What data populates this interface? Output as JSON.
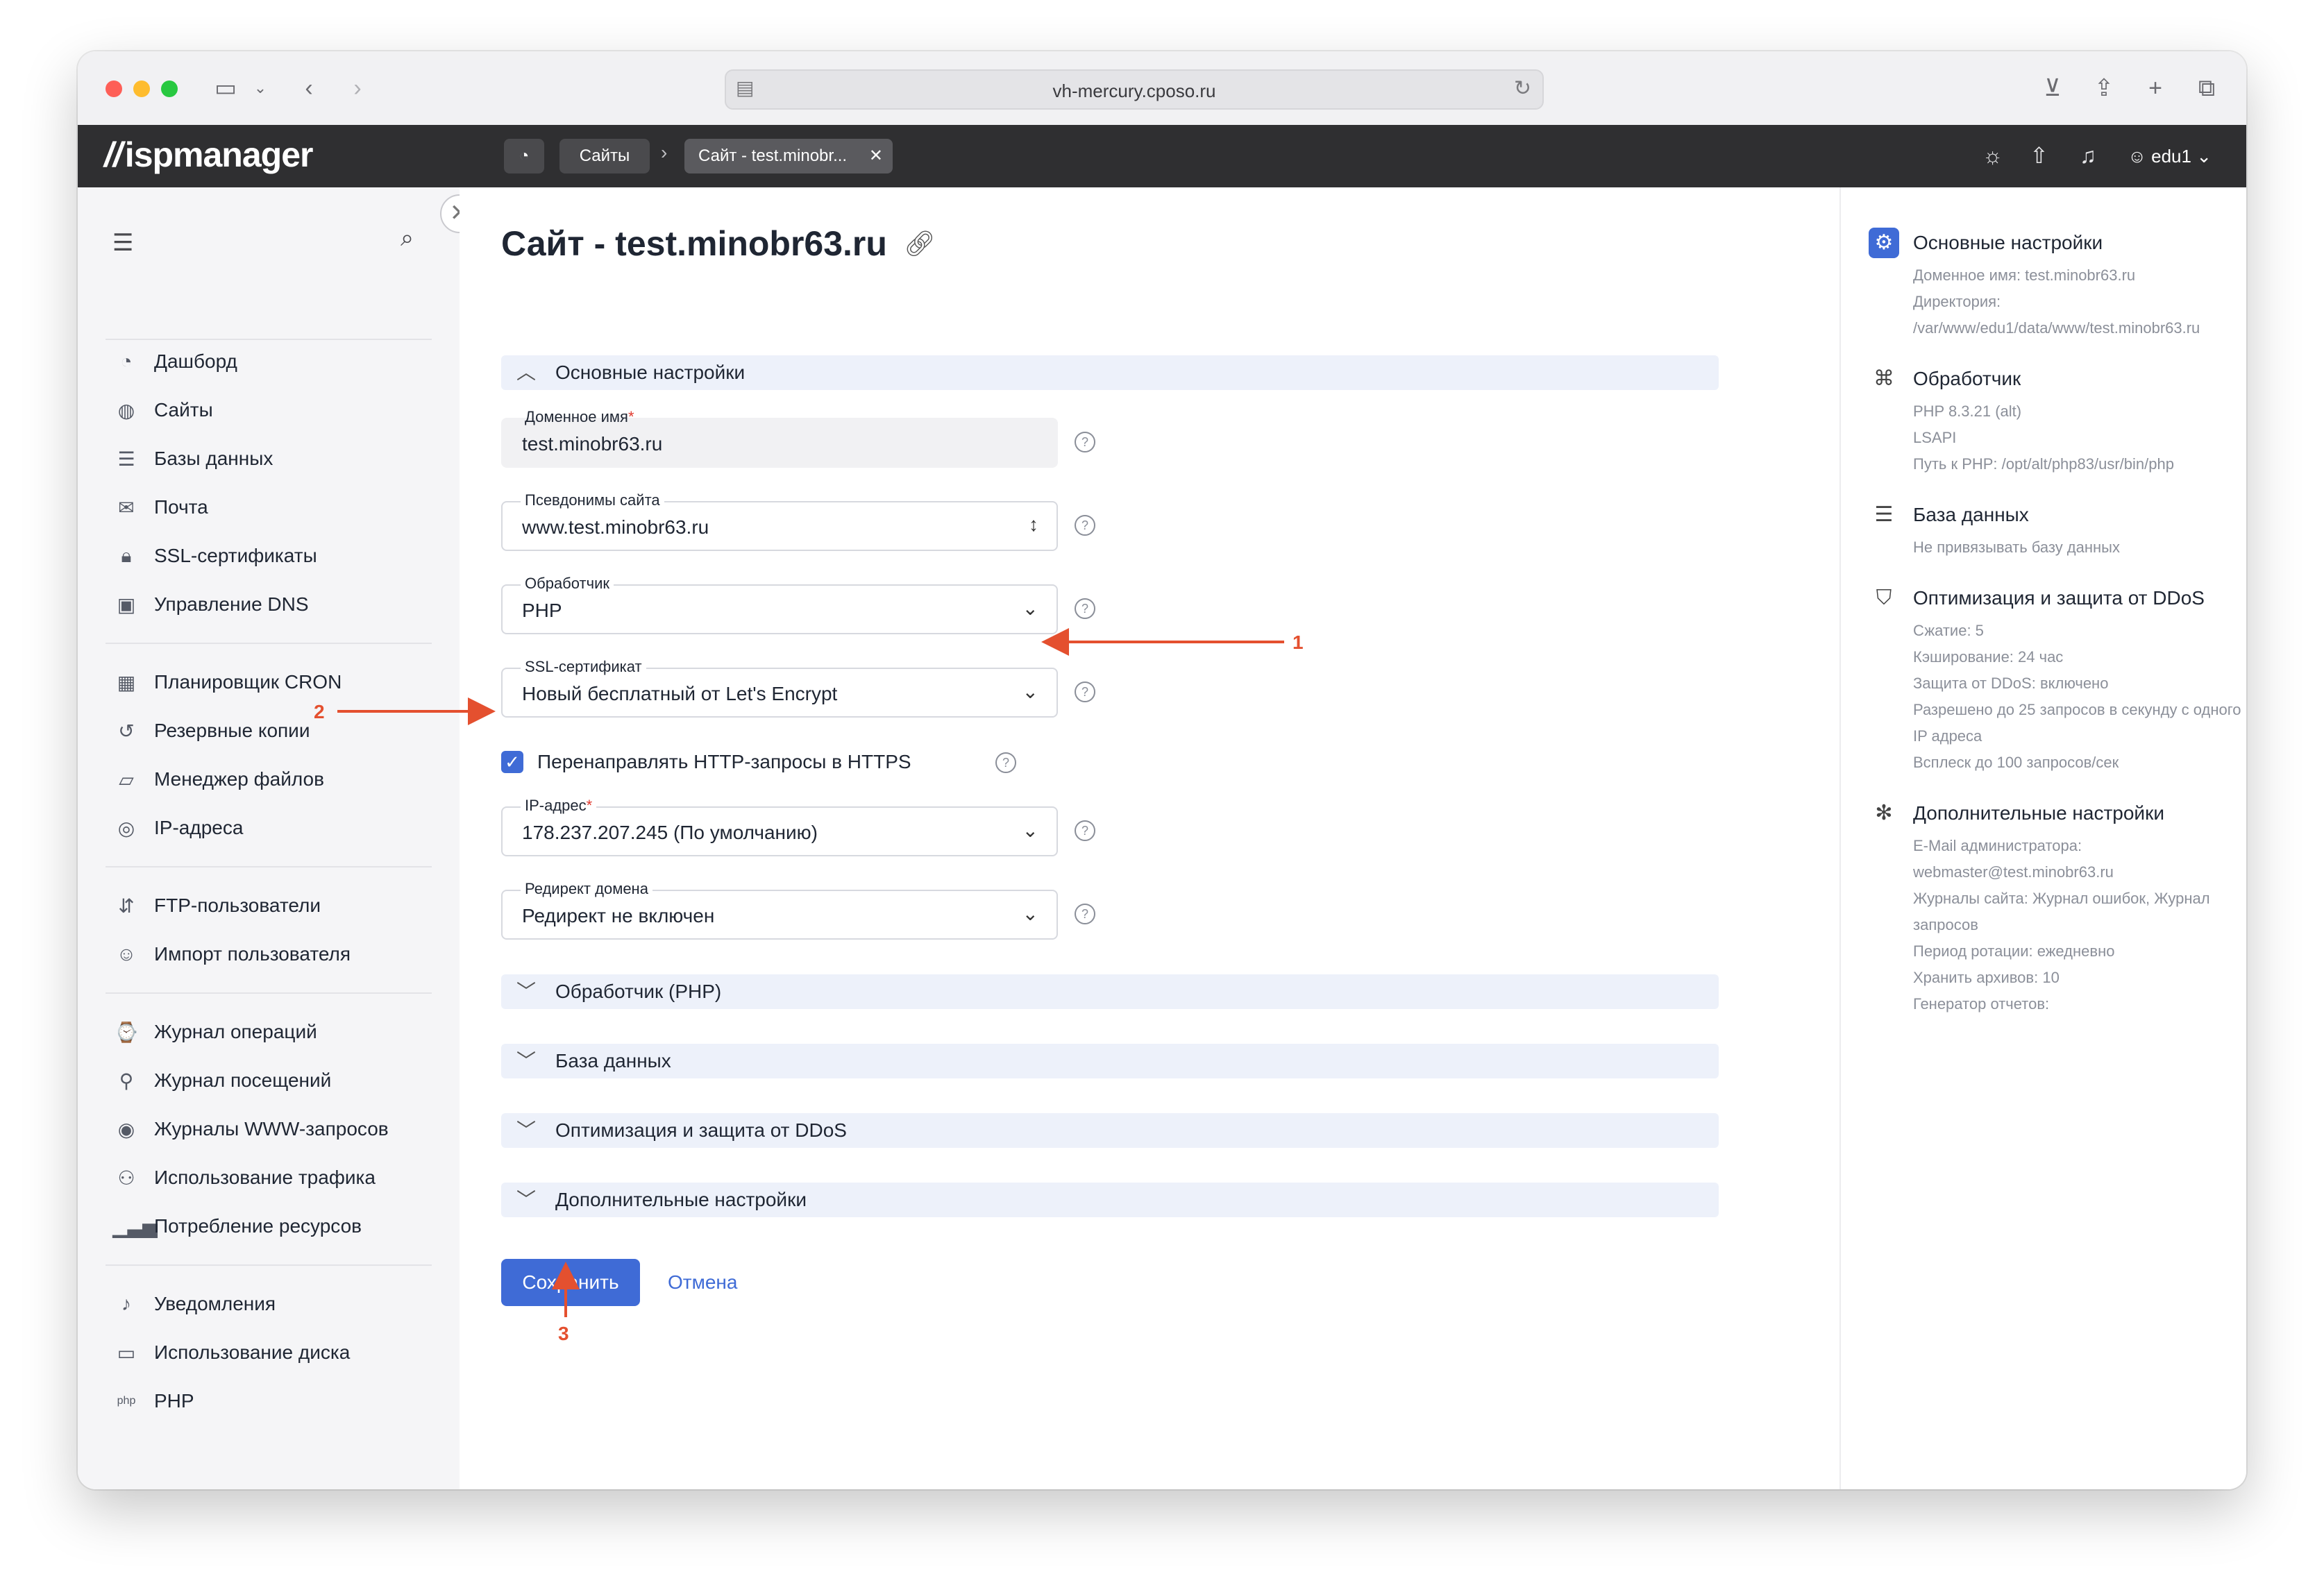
{
  "browser": {
    "url": "vh-mercury.cposo.ru"
  },
  "header": {
    "logo": "ispmanager",
    "breadcrumb_root": "Сайты",
    "breadcrumb_current": "Сайт - test.minobr...",
    "user": "edu1"
  },
  "sidebar": {
    "groups": [
      [
        {
          "label": "Дашборд",
          "icon": "dashboard-icon"
        },
        {
          "label": "Сайты",
          "icon": "globe-icon"
        },
        {
          "label": "Базы данных",
          "icon": "database-icon"
        },
        {
          "label": "Почта",
          "icon": "mail-icon"
        },
        {
          "label": "SSL-сертификаты",
          "icon": "lock-icon"
        },
        {
          "label": "Управление DNS",
          "icon": "dns-icon"
        }
      ],
      [
        {
          "label": "Планировщик CRON",
          "icon": "calendar-icon"
        },
        {
          "label": "Резервные копии",
          "icon": "backup-icon"
        },
        {
          "label": "Менеджер файлов",
          "icon": "folder-icon"
        },
        {
          "label": "IP-адреса",
          "icon": "ip-icon"
        }
      ],
      [
        {
          "label": "FTP-пользователи",
          "icon": "ftp-icon"
        },
        {
          "label": "Импорт пользователя",
          "icon": "user-import-icon"
        }
      ],
      [
        {
          "label": "Журнал операций",
          "icon": "log-icon"
        },
        {
          "label": "Журнал посещений",
          "icon": "visits-log-icon"
        },
        {
          "label": "Журналы WWW-запросов",
          "icon": "www-log-icon"
        },
        {
          "label": "Использование трафика",
          "icon": "traffic-icon"
        },
        {
          "label": "Потребление ресурсов",
          "icon": "resources-icon"
        }
      ],
      [
        {
          "label": "Уведомления",
          "icon": "bell-icon"
        },
        {
          "label": "Использование диска",
          "icon": "disk-icon"
        },
        {
          "label": "PHP",
          "icon": "php-icon"
        }
      ]
    ]
  },
  "main": {
    "title": "Сайт - test.minobr63.ru",
    "section_main": "Основные настройки",
    "fields": {
      "domain": {
        "label": "Доменное имя",
        "value": "test.minobr63.ru"
      },
      "aliases": {
        "label": "Псевдонимы сайта",
        "value": "www.test.minobr63.ru"
      },
      "handler": {
        "label": "Обработчик",
        "value": "PHP"
      },
      "ssl": {
        "label": "SSL-сертификат",
        "value": "Новый бесплатный от Let's Encrypt"
      },
      "ip": {
        "label": "IP-адрес",
        "value": "178.237.207.245 (По умолчанию)"
      },
      "redirect": {
        "label": "Редирект домена",
        "value": "Редирект не включен"
      }
    },
    "redirect_https_label": "Перенаправлять HTTP-запросы в HTTPS",
    "redirect_https_checked": true,
    "sections_collapsed": [
      "Обработчик (PHP)",
      "База данных",
      "Оптимизация и защита от DDoS",
      "Дополнительные настройки"
    ],
    "save_label": "Сохранить",
    "cancel_label": "Отмена"
  },
  "summary": {
    "blocks": [
      {
        "title": "Основные настройки",
        "icon": "gear-icon",
        "lines": [
          "Доменное имя: test.minobr63.ru",
          "Директория:",
          "/var/www/edu1/data/www/test.minobr63.ru"
        ]
      },
      {
        "title": "Обработчик",
        "icon": "handler-icon",
        "lines": [
          "PHP 8.3.21 (alt)",
          "LSAPI",
          "Путь к PHP: /opt/alt/php83/usr/bin/php"
        ]
      },
      {
        "title": "База данных",
        "icon": "database-icon",
        "lines": [
          "Не привязывать базу данных"
        ]
      },
      {
        "title": "Оптимизация и защита от DDoS",
        "icon": "shield-icon",
        "lines": [
          "Сжатие: 5",
          "Кэширование: 24 час",
          "Защита от DDoS: включено",
          "Разрешено до 25 запросов в секунду с одного",
          "IP адреса",
          "Всплеск до 100 запросов/сек"
        ]
      },
      {
        "title": "Дополнительные настройки",
        "icon": "settings-icon",
        "lines": [
          "E-Mail администратора:",
          "webmaster@test.minobr63.ru",
          "Журналы сайта: Журнал ошибок, Журнал",
          "запросов",
          "Период ротации: ежедневно",
          "Хранить архивов: 10",
          "Генератор отчетов:"
        ]
      }
    ]
  },
  "annotations": {
    "one": "1",
    "two": "2",
    "three": "3",
    "color": "#e4502f"
  }
}
